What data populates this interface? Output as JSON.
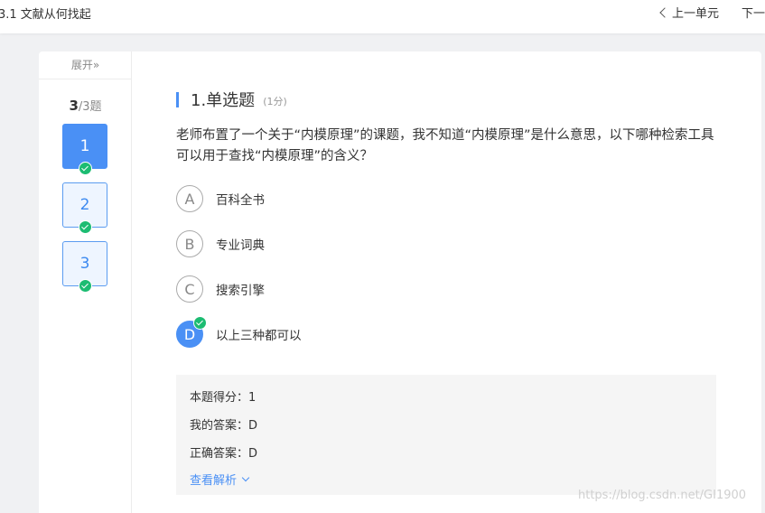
{
  "header": {
    "title": "3.1 文献从何找起",
    "prev_label": "上一单元",
    "next_label": "下一"
  },
  "sidebar": {
    "expand_label": "展开»",
    "counter_done": "3",
    "counter_total": "/3题",
    "questions": [
      {
        "label": "1",
        "answered": true,
        "active": true
      },
      {
        "label": "2",
        "answered": true,
        "active": false
      },
      {
        "label": "3",
        "answered": true,
        "active": false
      }
    ]
  },
  "question": {
    "title": "1.单选题",
    "score": "(1分)",
    "stem": "老师布置了一个关于“内模原理”的课题，我不知道“内模原理”是什么意思，以下哪种检索工具可以用于查找“内模原理”的含义？",
    "options": [
      {
        "letter": "A",
        "text": "百科全书"
      },
      {
        "letter": "B",
        "text": "专业词典"
      },
      {
        "letter": "C",
        "text": "搜索引擎"
      },
      {
        "letter": "D",
        "text": "以上三种都可以"
      }
    ],
    "selected": "D"
  },
  "result": {
    "score_text": "本题得分：1",
    "my_answer": "我的答案：D",
    "correct_answer": "正确答案：D",
    "analysis_label": "查看解析"
  },
  "watermark": "https://blog.csdn.net/GI1900",
  "colors": {
    "accent": "#4a90f5",
    "correct": "#1cbc72",
    "panel_bg": "#f5f5f5"
  }
}
